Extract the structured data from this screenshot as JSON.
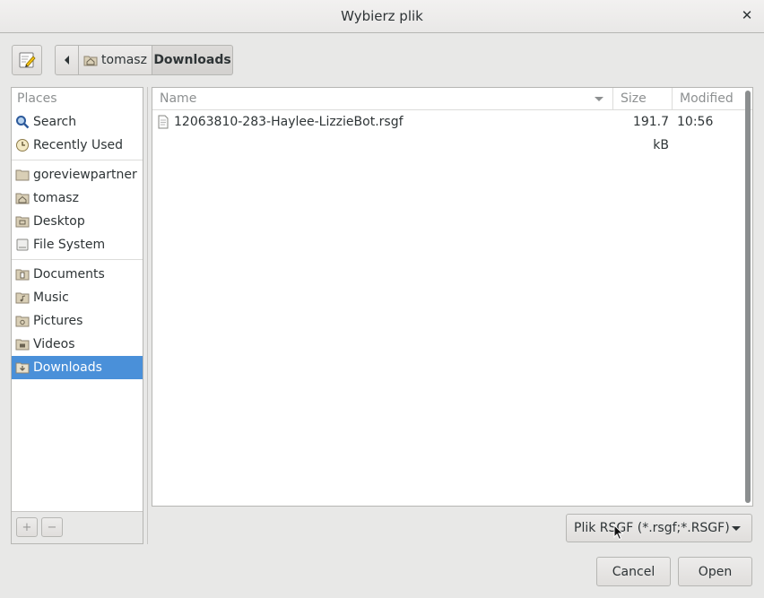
{
  "window": {
    "title": "Wybierz plik"
  },
  "path_bar": {
    "crumbs": [
      {
        "label": "tomasz",
        "icon": "home-folder-icon"
      },
      {
        "label": "Downloads"
      }
    ]
  },
  "sidebar": {
    "header": "Places",
    "groups": [
      [
        {
          "label": "Search",
          "icon": "search-icon"
        },
        {
          "label": "Recently Used",
          "icon": "recent-clock-icon"
        }
      ],
      [
        {
          "label": "goreviewpartner",
          "icon": "folder-icon"
        },
        {
          "label": "tomasz",
          "icon": "home-folder-icon"
        },
        {
          "label": "Desktop",
          "icon": "desktop-folder-icon"
        },
        {
          "label": "File System",
          "icon": "drive-icon"
        }
      ],
      [
        {
          "label": "Documents",
          "icon": "documents-folder-icon"
        },
        {
          "label": "Music",
          "icon": "music-folder-icon"
        },
        {
          "label": "Pictures",
          "icon": "pictures-folder-icon"
        },
        {
          "label": "Videos",
          "icon": "videos-folder-icon"
        },
        {
          "label": "Downloads",
          "icon": "downloads-folder-icon",
          "selected": true
        }
      ]
    ],
    "add_label": "+",
    "remove_label": "−"
  },
  "file_list": {
    "columns": {
      "name": "Name",
      "size": "Size",
      "modified": "Modified"
    },
    "rows": [
      {
        "name": "12063810-283-Haylee-LizzieBot.rsgf",
        "size": "191.7 kB",
        "modified": "10:56",
        "icon": "document-icon"
      }
    ]
  },
  "filter": {
    "selected": "Plik RSGF (*.rsgf;*.RSGF)"
  },
  "buttons": {
    "cancel": "Cancel",
    "open": "Open"
  },
  "colors": {
    "accent": "#4a90d9",
    "background": "#e8e8e7"
  }
}
